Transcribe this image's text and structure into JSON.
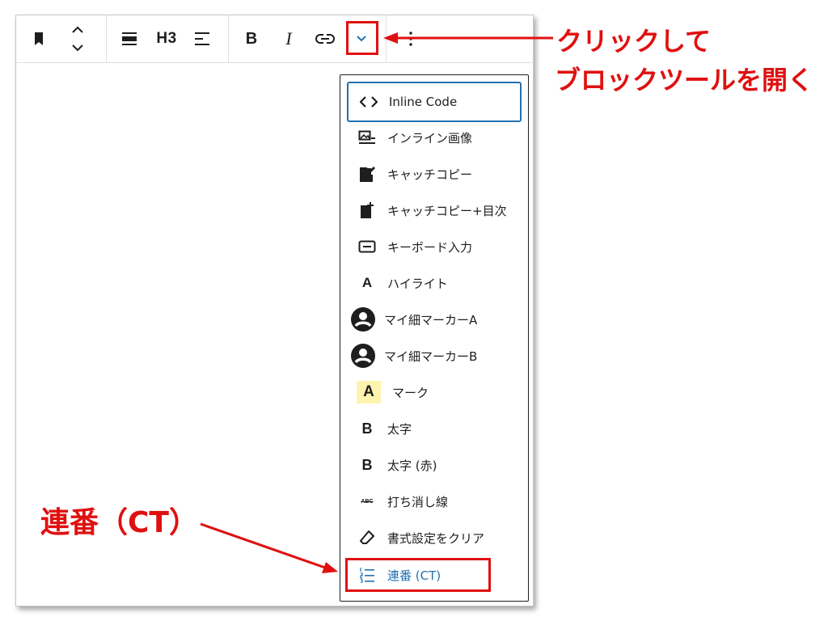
{
  "toolbar": {
    "heading_level": "H3",
    "bold_label": "B",
    "italic_label": "I"
  },
  "menu": {
    "items": [
      {
        "label": "Inline Code",
        "icon": "code-icon"
      },
      {
        "label": "インライン画像",
        "icon": "inline-image-icon"
      },
      {
        "label": "キャッチコピー",
        "icon": "edit-note-icon"
      },
      {
        "label": "キャッチコピー+目次",
        "icon": "edit-note-plus-icon"
      },
      {
        "label": "キーボード入力",
        "icon": "keyboard-icon"
      },
      {
        "label": "ハイライト",
        "icon": "letter-a-icon",
        "icon_text": "A"
      },
      {
        "label": "マイ細マーカーA",
        "icon": "user-circle-icon"
      },
      {
        "label": "マイ細マーカーB",
        "icon": "user-circle-icon"
      },
      {
        "label": "マーク",
        "icon": "mark-icon",
        "icon_text": "A"
      },
      {
        "label": "太字",
        "icon": "bold-icon",
        "icon_text": "B"
      },
      {
        "label": "太字 (赤)",
        "icon": "bold-icon",
        "icon_text": "B"
      },
      {
        "label": "打ち消し線",
        "icon": "strikethrough-icon",
        "icon_text": "ABC"
      },
      {
        "label": "書式設定をクリア",
        "icon": "eraser-icon"
      },
      {
        "label": "連番 (CT)",
        "icon": "ordered-list-icon"
      }
    ]
  },
  "annotations": {
    "top_line1": "クリックして",
    "top_line2": "ブロックツールを開く",
    "bottom": "連番（CT）"
  },
  "colors": {
    "annotation_red": "#e01010",
    "focus_blue": "#2271b1",
    "mark_bg": "#fff3b0"
  }
}
